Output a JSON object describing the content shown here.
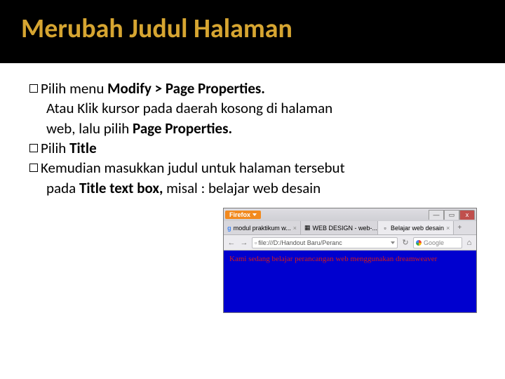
{
  "slide": {
    "title": "Merubah Judul Halaman",
    "b1_pre": "Pilih menu ",
    "b1_bold": "Modify > Page Properties.",
    "b1_line2a": "Atau Klik kursor pada daerah kosong di halaman",
    "b1_line2b": "web, lalu pilih ",
    "b1_line2b_bold": "Page Properties.",
    "b2_pre": "Pilih ",
    "b2_bold": "Title",
    "b3_pre": "Kemudian masukkan judul untuk halaman tersebut",
    "b3_line2a": "pada ",
    "b3_bold": "Title text box,",
    "b3_line2b": " misal : belajar web desain"
  },
  "browser": {
    "ff_label": "Firefox",
    "min": "—",
    "max": "▭",
    "close": "x",
    "tabs": [
      {
        "icon": "g",
        "label": "modul praktikum w...",
        "active": false
      },
      {
        "icon": "□",
        "label": "WEB DESIGN - web-...",
        "active": false
      },
      {
        "icon": "□",
        "label": "Belajar web desain",
        "active": true
      }
    ],
    "plus": "+",
    "back": "←",
    "fwd": "→",
    "url": "file:///D:/Handout Baru/Peranc",
    "reload": "↻",
    "search_ph": "Google",
    "home": "⌂",
    "page_text": "Kami sedang belajar perancangan web menggunakan dreamweaver"
  }
}
